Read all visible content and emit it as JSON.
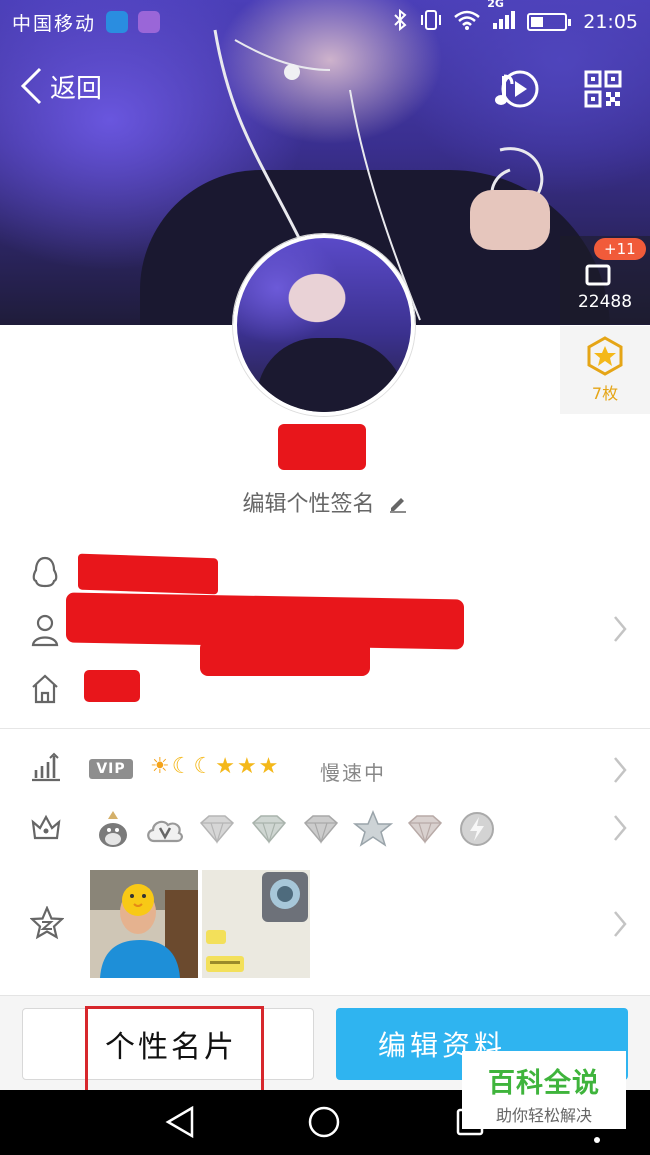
{
  "status_bar": {
    "carrier": "中国移动",
    "network": "2G",
    "time": "21:05"
  },
  "header": {
    "back_label": "返回"
  },
  "likes": {
    "bubble": "+11",
    "count": "22488"
  },
  "medals": {
    "label": "7枚"
  },
  "profile": {
    "signature": "编辑个性签名"
  },
  "vip": {
    "badge": "VIP",
    "level_icons": [
      "☀",
      "☾",
      "☾",
      "★",
      "★",
      "★"
    ],
    "speed_label": "慢速中"
  },
  "bottom": {
    "card_button": "个性名片",
    "edit_button": "编辑资料"
  },
  "watermark": {
    "title": "百科全说",
    "subtitle": "助你轻松解决"
  },
  "colors": {
    "accent": "#2fb4f0",
    "medal": "#e5a516",
    "badge_red": "#f15b3a",
    "watermark_green": "#3fb43c"
  }
}
